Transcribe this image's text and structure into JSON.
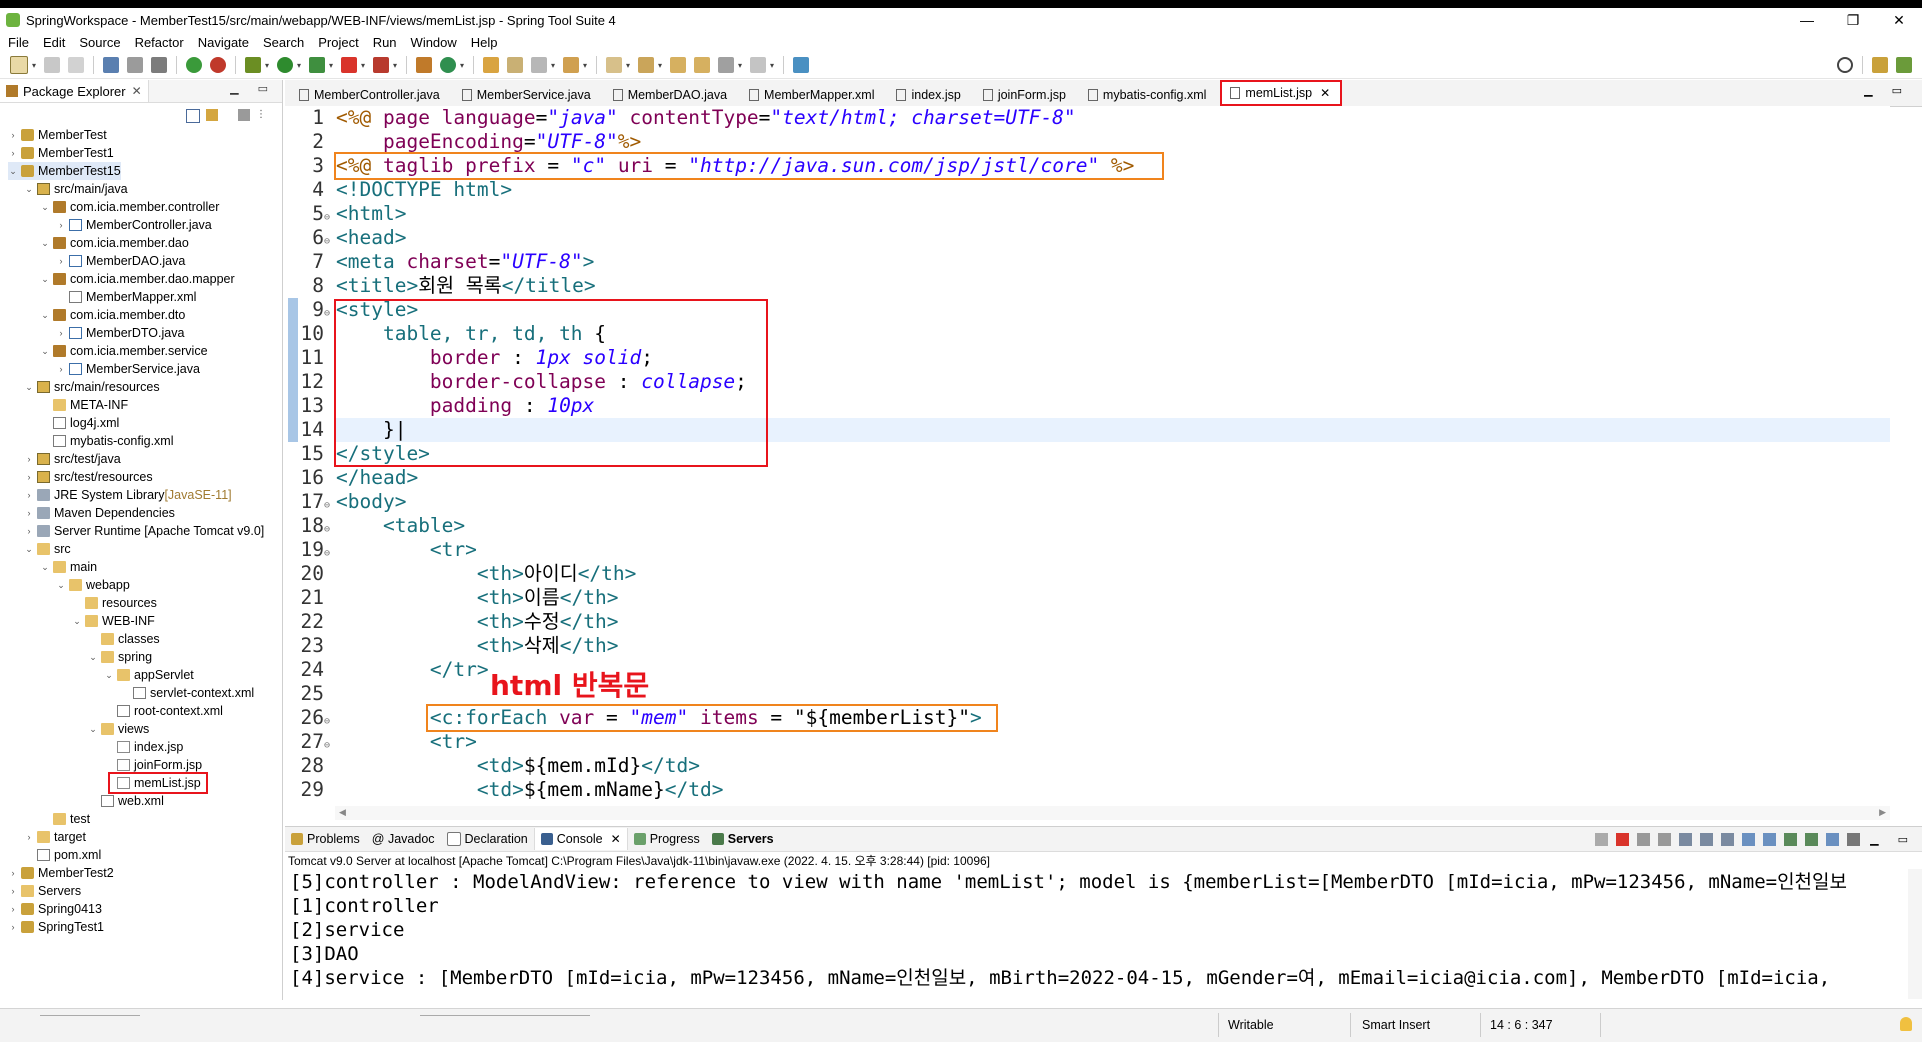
{
  "window": {
    "title": "SpringWorkspace - MemberTest15/src/main/webapp/WEB-INF/views/memList.jsp - Spring Tool Suite 4",
    "controls": [
      "—",
      "❐",
      "✕"
    ]
  },
  "menu": [
    "File",
    "Edit",
    "Source",
    "Refactor",
    "Navigate",
    "Search",
    "Project",
    "Run",
    "Window",
    "Help"
  ],
  "package_explorer": {
    "title": "Package Explorer",
    "tree": [
      {
        "label": "MemberTest",
        "indent": 0,
        "twisty": "›",
        "icon": "project"
      },
      {
        "label": "MemberTest1",
        "indent": 0,
        "twisty": "›",
        "icon": "project"
      },
      {
        "label": "MemberTest15",
        "indent": 0,
        "twisty": "⌄",
        "icon": "project",
        "selected": true
      },
      {
        "label": "src/main/java",
        "indent": 1,
        "twisty": "⌄",
        "icon": "srcfolder"
      },
      {
        "label": "com.icia.member.controller",
        "indent": 2,
        "twisty": "⌄",
        "icon": "package"
      },
      {
        "label": "MemberController.java",
        "indent": 3,
        "twisty": "›",
        "icon": "java"
      },
      {
        "label": "com.icia.member.dao",
        "indent": 2,
        "twisty": "⌄",
        "icon": "package"
      },
      {
        "label": "MemberDAO.java",
        "indent": 3,
        "twisty": "›",
        "icon": "java"
      },
      {
        "label": "com.icia.member.dao.mapper",
        "indent": 2,
        "twisty": "⌄",
        "icon": "package"
      },
      {
        "label": "MemberMapper.xml",
        "indent": 3,
        "twisty": "",
        "icon": "xml"
      },
      {
        "label": "com.icia.member.dto",
        "indent": 2,
        "twisty": "⌄",
        "icon": "package"
      },
      {
        "label": "MemberDTO.java",
        "indent": 3,
        "twisty": "›",
        "icon": "java"
      },
      {
        "label": "com.icia.member.service",
        "indent": 2,
        "twisty": "⌄",
        "icon": "package"
      },
      {
        "label": "MemberService.java",
        "indent": 3,
        "twisty": "›",
        "icon": "java"
      },
      {
        "label": "src/main/resources",
        "indent": 1,
        "twisty": "⌄",
        "icon": "srcfolder"
      },
      {
        "label": "META-INF",
        "indent": 2,
        "twisty": "",
        "icon": "folder"
      },
      {
        "label": "log4j.xml",
        "indent": 2,
        "twisty": "",
        "icon": "xml"
      },
      {
        "label": "mybatis-config.xml",
        "indent": 2,
        "twisty": "",
        "icon": "xml"
      },
      {
        "label": "src/test/java",
        "indent": 1,
        "twisty": "›",
        "icon": "srcfolder"
      },
      {
        "label": "src/test/resources",
        "indent": 1,
        "twisty": "›",
        "icon": "srcfolder"
      },
      {
        "label": "JRE System Library",
        "suffix": " [JavaSE-11]",
        "indent": 1,
        "twisty": "›",
        "icon": "lib"
      },
      {
        "label": "Maven Dependencies",
        "indent": 1,
        "twisty": "›",
        "icon": "lib"
      },
      {
        "label": "Server Runtime [Apache Tomcat v9.0]",
        "indent": 1,
        "twisty": "›",
        "icon": "lib"
      },
      {
        "label": "src",
        "indent": 1,
        "twisty": "⌄",
        "icon": "folder"
      },
      {
        "label": "main",
        "indent": 2,
        "twisty": "⌄",
        "icon": "folder"
      },
      {
        "label": "webapp",
        "indent": 3,
        "twisty": "⌄",
        "icon": "folder"
      },
      {
        "label": "resources",
        "indent": 4,
        "twisty": "",
        "icon": "folder"
      },
      {
        "label": "WEB-INF",
        "indent": 4,
        "twisty": "⌄",
        "icon": "folder"
      },
      {
        "label": "classes",
        "indent": 5,
        "twisty": "",
        "icon": "folder"
      },
      {
        "label": "spring",
        "indent": 5,
        "twisty": "⌄",
        "icon": "folder"
      },
      {
        "label": "appServlet",
        "indent": 6,
        "twisty": "⌄",
        "icon": "folder"
      },
      {
        "label": "servlet-context.xml",
        "indent": 7,
        "twisty": "",
        "icon": "xml"
      },
      {
        "label": "root-context.xml",
        "indent": 6,
        "twisty": "",
        "icon": "xml"
      },
      {
        "label": "views",
        "indent": 5,
        "twisty": "⌄",
        "icon": "folder"
      },
      {
        "label": "index.jsp",
        "indent": 6,
        "twisty": "",
        "icon": "jsp"
      },
      {
        "label": "joinForm.jsp",
        "indent": 6,
        "twisty": "",
        "icon": "jsp"
      },
      {
        "label": "memList.jsp",
        "indent": 6,
        "twisty": "",
        "icon": "jsp",
        "highlight": true
      },
      {
        "label": "web.xml",
        "indent": 5,
        "twisty": "",
        "icon": "xml"
      },
      {
        "label": "test",
        "indent": 2,
        "twisty": "",
        "icon": "folder"
      },
      {
        "label": "target",
        "indent": 1,
        "twisty": "›",
        "icon": "folder"
      },
      {
        "label": "pom.xml",
        "indent": 1,
        "twisty": "",
        "icon": "xml"
      },
      {
        "label": "MemberTest2",
        "indent": 0,
        "twisty": "›",
        "icon": "project"
      },
      {
        "label": "Servers",
        "indent": 0,
        "twisty": "›",
        "icon": "folder"
      },
      {
        "label": "Spring0413",
        "indent": 0,
        "twisty": "›",
        "icon": "project"
      },
      {
        "label": "SpringTest1",
        "indent": 0,
        "twisty": "›",
        "icon": "project"
      }
    ]
  },
  "editor_tabs": [
    {
      "label": "MemberController.java",
      "active": false
    },
    {
      "label": "MemberService.java",
      "active": false
    },
    {
      "label": "MemberDAO.java",
      "active": false
    },
    {
      "label": "MemberMapper.xml",
      "active": false
    },
    {
      "label": "index.jsp",
      "active": false
    },
    {
      "label": "joinForm.jsp",
      "active": false
    },
    {
      "label": "mybatis-config.xml",
      "active": false
    },
    {
      "label": "memList.jsp",
      "active": true
    }
  ],
  "code_lines": [
    {
      "n": "1",
      "fold": "",
      "parts": [
        [
          "jsp",
          "<%@ "
        ],
        [
          "attr",
          "page "
        ],
        [
          "attr",
          "language"
        ],
        [
          "plain",
          "="
        ],
        [
          "str",
          "\"java\" "
        ],
        [
          "attr",
          "contentType"
        ],
        [
          "plain",
          "="
        ],
        [
          "str",
          "\"text/html; charset=UTF-8\""
        ]
      ]
    },
    {
      "n": "2",
      "fold": "",
      "parts": [
        [
          "plain",
          "    "
        ],
        [
          "attr",
          "pageEncoding"
        ],
        [
          "plain",
          "="
        ],
        [
          "str",
          "\"UTF-8\""
        ],
        [
          "jsp",
          "%>"
        ]
      ]
    },
    {
      "n": "3",
      "fold": "",
      "parts": [
        [
          "jsp",
          "<%@ "
        ],
        [
          "attr",
          "taglib "
        ],
        [
          "attr",
          "prefix"
        ],
        [
          "plain",
          " = "
        ],
        [
          "str",
          "\"c\" "
        ],
        [
          "attr",
          "uri"
        ],
        [
          "plain",
          " = "
        ],
        [
          "str",
          "\"http://java.sun.com/jsp/jstl/core\" "
        ],
        [
          "jsp",
          "%>"
        ]
      ]
    },
    {
      "n": "4",
      "fold": "",
      "parts": [
        [
          "tag",
          "<!DOCTYPE "
        ],
        [
          "tag",
          "html"
        ],
        [
          "tag",
          ">"
        ]
      ]
    },
    {
      "n": "5",
      "fold": "⊖",
      "parts": [
        [
          "tag",
          "<html>"
        ]
      ]
    },
    {
      "n": "6",
      "fold": "⊖",
      "parts": [
        [
          "tag",
          "<head>"
        ]
      ]
    },
    {
      "n": "7",
      "fold": "",
      "parts": [
        [
          "tag",
          "<meta "
        ],
        [
          "attr",
          "charset"
        ],
        [
          "plain",
          "="
        ],
        [
          "str",
          "\"UTF-8\""
        ],
        [
          "tag",
          ">"
        ]
      ]
    },
    {
      "n": "8",
      "fold": "",
      "parts": [
        [
          "tag",
          "<title>"
        ],
        [
          "plain",
          "회원 목록"
        ],
        [
          "tag",
          "</title>"
        ]
      ]
    },
    {
      "n": "9",
      "fold": "⊖",
      "parts": [
        [
          "tag",
          "<style>"
        ]
      ]
    },
    {
      "n": "10",
      "fold": "",
      "parts": [
        [
          "plain",
          "    "
        ],
        [
          "css-sel",
          "table, tr, td, th "
        ],
        [
          "plain",
          "{"
        ]
      ]
    },
    {
      "n": "11",
      "fold": "",
      "parts": [
        [
          "plain",
          "        "
        ],
        [
          "css-prop",
          "border "
        ],
        [
          "plain",
          ": "
        ],
        [
          "css-val",
          "1px solid"
        ],
        [
          "plain",
          ";"
        ]
      ]
    },
    {
      "n": "12",
      "fold": "",
      "parts": [
        [
          "plain",
          "        "
        ],
        [
          "css-prop",
          "border-collapse "
        ],
        [
          "plain",
          ": "
        ],
        [
          "css-val",
          "collapse"
        ],
        [
          "plain",
          ";"
        ]
      ]
    },
    {
      "n": "13",
      "fold": "",
      "parts": [
        [
          "plain",
          "        "
        ],
        [
          "css-prop",
          "padding "
        ],
        [
          "plain",
          ": "
        ],
        [
          "css-val",
          "10px"
        ]
      ]
    },
    {
      "n": "14",
      "fold": "",
      "parts": [
        [
          "plain",
          "    }|"
        ]
      ]
    },
    {
      "n": "15",
      "fold": "",
      "parts": [
        [
          "tag",
          "</style>"
        ]
      ]
    },
    {
      "n": "16",
      "fold": "",
      "parts": [
        [
          "tag",
          "</head>"
        ]
      ]
    },
    {
      "n": "17",
      "fold": "⊖",
      "parts": [
        [
          "tag",
          "<body>"
        ]
      ]
    },
    {
      "n": "18",
      "fold": "⊖",
      "parts": [
        [
          "plain",
          "    "
        ],
        [
          "tag",
          "<table>"
        ]
      ]
    },
    {
      "n": "19",
      "fold": "⊖",
      "parts": [
        [
          "plain",
          "        "
        ],
        [
          "tag",
          "<tr>"
        ]
      ]
    },
    {
      "n": "20",
      "fold": "",
      "parts": [
        [
          "plain",
          "            "
        ],
        [
          "tag",
          "<th>"
        ],
        [
          "plain",
          "아이디"
        ],
        [
          "tag",
          "</th>"
        ]
      ]
    },
    {
      "n": "21",
      "fold": "",
      "parts": [
        [
          "plain",
          "            "
        ],
        [
          "tag",
          "<th>"
        ],
        [
          "plain",
          "이름"
        ],
        [
          "tag",
          "</th>"
        ]
      ]
    },
    {
      "n": "22",
      "fold": "",
      "parts": [
        [
          "plain",
          "            "
        ],
        [
          "tag",
          "<th>"
        ],
        [
          "plain",
          "수정"
        ],
        [
          "tag",
          "</th>"
        ]
      ]
    },
    {
      "n": "23",
      "fold": "",
      "parts": [
        [
          "plain",
          "            "
        ],
        [
          "tag",
          "<th>"
        ],
        [
          "plain",
          "삭제"
        ],
        [
          "tag",
          "</th>"
        ]
      ]
    },
    {
      "n": "24",
      "fold": "",
      "parts": [
        [
          "plain",
          "        "
        ],
        [
          "tag",
          "</tr>"
        ]
      ]
    },
    {
      "n": "25",
      "fold": "",
      "parts": [
        [
          "plain",
          ""
        ]
      ]
    },
    {
      "n": "26",
      "fold": "⊖",
      "parts": [
        [
          "plain",
          "        "
        ],
        [
          "tag",
          "<c:forEach "
        ],
        [
          "attr",
          "var"
        ],
        [
          "plain",
          " = "
        ],
        [
          "str",
          "\"mem\" "
        ],
        [
          "attr",
          "items"
        ],
        [
          "plain",
          " = "
        ],
        [
          "plain",
          "\"${memberList}\""
        ],
        [
          "tag",
          ">"
        ]
      ]
    },
    {
      "n": "27",
      "fold": "⊖",
      "parts": [
        [
          "plain",
          "        "
        ],
        [
          "tag",
          "<tr>"
        ]
      ]
    },
    {
      "n": "28",
      "fold": "",
      "parts": [
        [
          "plain",
          "            "
        ],
        [
          "tag",
          "<td>"
        ],
        [
          "plain",
          "${mem.mId}"
        ],
        [
          "tag",
          "</td>"
        ]
      ]
    },
    {
      "n": "29",
      "fold": "",
      "parts": [
        [
          "plain",
          "            "
        ],
        [
          "tag",
          "<td>"
        ],
        [
          "plain",
          "${mem.mName}"
        ],
        [
          "tag",
          "</td>"
        ]
      ]
    }
  ],
  "annotation": "html 반복문",
  "bottom_tabs": [
    {
      "label": "Problems",
      "active": false
    },
    {
      "label": "@ Javadoc",
      "active": false
    },
    {
      "label": "Declaration",
      "active": false
    },
    {
      "label": "Console",
      "active": true
    },
    {
      "label": "Progress",
      "active": false
    },
    {
      "label": "Servers",
      "active": false,
      "bold": true
    }
  ],
  "console": {
    "description": "Tomcat v9.0 Server at localhost [Apache Tomcat] C:\\Program Files\\Java\\jdk-11\\bin\\javaw.exe  (2022. 4. 15. 오후 3:28:44) [pid: 10096]",
    "lines": [
      "[5]controller : ModelAndView: reference to view with name 'memList'; model is {memberList=[MemberDTO [mId=icia, mPw=123456, mName=인천일보",
      "[1]controller",
      "[2]service",
      "[3]DAO",
      "[4]service : [MemberDTO [mId=icia, mPw=123456, mName=인천일보, mBirth=2022-04-15, mGender=여, mEmail=icia@icia.com], MemberDTO [mId=icia,"
    ]
  },
  "status": {
    "writable": "Writable",
    "insert_mode": "Smart Insert",
    "position": "14 : 6 : 347"
  }
}
